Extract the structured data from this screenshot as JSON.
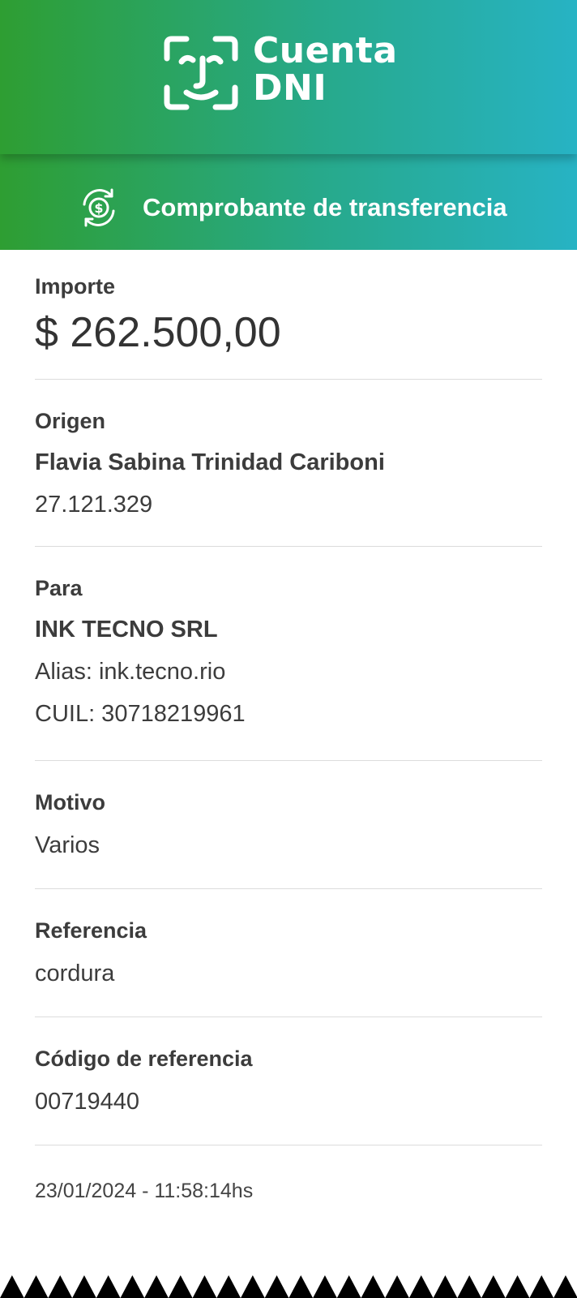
{
  "app": {
    "logo_line1": "Cuenta",
    "logo_line2": "DNI",
    "logo_icon": "face-scan-icon",
    "screen_title": "Comprobante de transferencia",
    "screen_icon": "money-transfer-icon"
  },
  "receipt": {
    "amount_label": "Importe",
    "amount": "$ 262.500,00",
    "origin_label": "Origen",
    "origin_name": "Flavia Sabina Trinidad Cariboni",
    "origin_id": "27.121.329",
    "to_label": "Para",
    "to_name": "INK TECNO SRL",
    "to_alias": "Alias: ink.tecno.rio",
    "to_cuil": "CUIL: 30718219961",
    "reason_label": "Motivo",
    "reason": "Varios",
    "reference_label": "Referencia",
    "reference": "cordura",
    "code_label": "Código de referencia",
    "code": "00719440",
    "timestamp": "23/01/2024 - 11:58:14hs"
  },
  "colors": {
    "header_gradient_start": "#2e9e32",
    "header_gradient_end": "#27b3c4",
    "text": "#3c3c3c",
    "divider": "#dcdcdc",
    "zigzag": "#000000"
  }
}
